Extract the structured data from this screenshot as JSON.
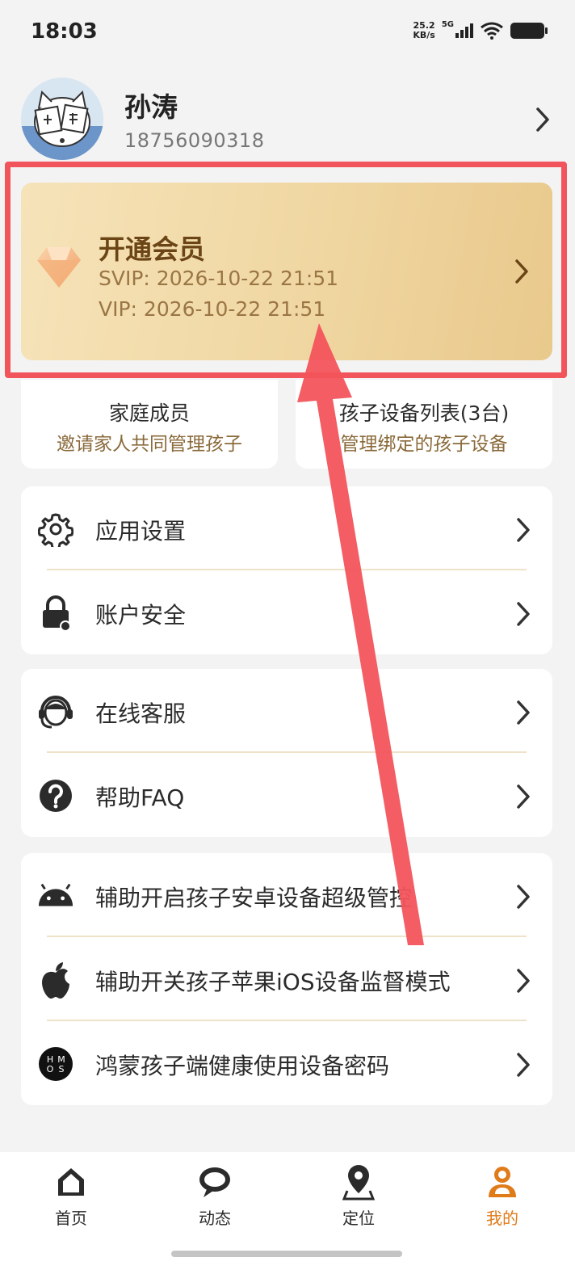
{
  "status_bar": {
    "time": "18:03",
    "net_speed_value": "25.2",
    "net_speed_unit": "KB/s",
    "network": "5G",
    "icons": [
      "signal-icon",
      "wifi-icon",
      "battery-icon"
    ]
  },
  "profile": {
    "name": "孙涛",
    "phone": "18756090318"
  },
  "vip": {
    "title": "开通会员",
    "svip": "SVIP: 2026-10-22 21:51",
    "vip": "VIP: 2026-10-22 21:51",
    "icon": "diamond-icon"
  },
  "quick": [
    {
      "title": "家庭成员",
      "subtitle": "邀请家人共同管理孩子"
    },
    {
      "title": "孩子设备列表(3台)",
      "subtitle": "管理绑定的孩子设备"
    }
  ],
  "menu": {
    "settings": [
      {
        "label": "应用设置",
        "icon": "gear-icon"
      },
      {
        "label": "账户安全",
        "icon": "lock-icon"
      }
    ],
    "support": [
      {
        "label": "在线客服",
        "icon": "headset-icon"
      },
      {
        "label": "帮助FAQ",
        "icon": "question-icon"
      }
    ],
    "devices": [
      {
        "label": "辅助开启孩子安卓设备超级管控",
        "icon": "android-icon"
      },
      {
        "label": "辅助开关孩子苹果iOS设备监督模式",
        "icon": "apple-icon"
      },
      {
        "label": "鸿蒙孩子端健康使用设备密码",
        "icon": "hmos-icon",
        "icon_text": [
          "H",
          "M",
          "O",
          "S"
        ]
      }
    ]
  },
  "tabs": [
    {
      "label": "首页",
      "icon": "home-icon"
    },
    {
      "label": "动态",
      "icon": "chat-icon"
    },
    {
      "label": "定位",
      "icon": "location-icon"
    },
    {
      "label": "我的",
      "icon": "profile-icon",
      "active": true
    }
  ],
  "colors": {
    "accent": "#e07b1a",
    "vip_title": "#6b4515",
    "vip_text": "#9a7644",
    "highlight": "#f2545b"
  }
}
